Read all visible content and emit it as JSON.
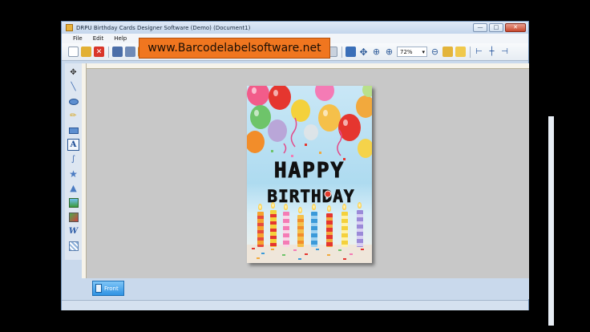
{
  "window": {
    "title": "DRPU Birthday Cards Designer Software (Demo) (Document1)",
    "buttons": [
      "—",
      "□",
      "✕"
    ]
  },
  "menu": [
    "File",
    "Edit",
    "Help"
  ],
  "toolbar": {
    "zoom_value": "72%",
    "zoom_arrow": "▾"
  },
  "banner": {
    "text": "www.Barcodelabelsoftware.net"
  },
  "card": {
    "line1": "HAPPY",
    "line2": "BIRTHDAY"
  },
  "pages": {
    "front_label": "Front"
  },
  "colors": {
    "banner": "#f0761f",
    "chrome": "#c9d9ec",
    "canvas": "#c8c8c8",
    "tab": "#2f93e3"
  },
  "icons": {
    "toolbar": [
      "new-document-icon",
      "open-folder-icon",
      "close-icon",
      "save-icon",
      "save-as-icon",
      "print-icon",
      "export-icon",
      "properties-icon",
      "print-preview-icon",
      "layers-icon",
      "database-icon",
      "undo-icon",
      "redo-icon",
      "copy-icon",
      "cut-icon",
      "paste-icon",
      "delete-icon",
      "group-icon",
      "ungroup-icon",
      "bring-front-icon",
      "grid-icon",
      "center-icon",
      "align-icon",
      "zoom-in-icon",
      "zoom-out-icon",
      "lock-icon",
      "unlock-icon",
      "align-left-icon",
      "align-center-icon",
      "align-right-icon"
    ],
    "left": [
      "pointer-icon",
      "line-icon",
      "ellipse-icon",
      "pencil-icon",
      "rectangle-icon",
      "text-icon",
      "curve-icon",
      "star-icon",
      "triangle-icon",
      "image-icon",
      "picture-library-icon",
      "word-art-icon",
      "pattern-icon"
    ]
  }
}
